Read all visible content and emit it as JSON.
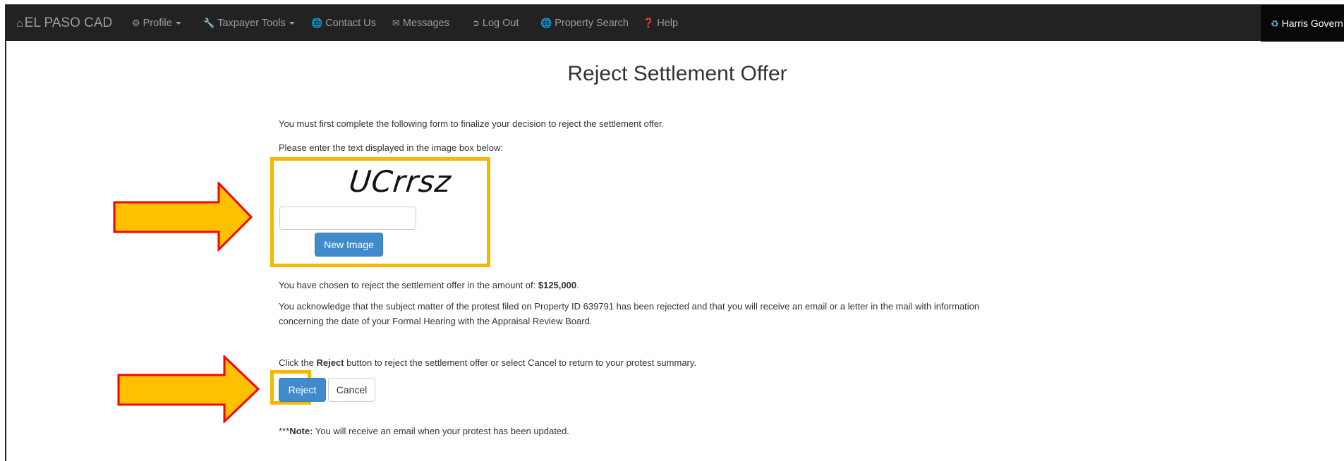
{
  "navbar": {
    "brand": "EL PASO CAD",
    "brand_icon": "home-icon",
    "items": [
      {
        "label": "Profile",
        "icon": "cogs-icon",
        "dropdown": true
      },
      {
        "label": "Taxpayer Tools",
        "icon": "wrench-icon",
        "dropdown": true
      },
      {
        "label": "Contact Us",
        "icon": "globe-icon"
      },
      {
        "label": "Messages",
        "icon": "envelope-icon"
      },
      {
        "label": "Log Out",
        "icon": "logout-icon"
      },
      {
        "label": "Property Search",
        "icon": "globe-icon"
      },
      {
        "label": "Help",
        "icon": "question-icon"
      }
    ],
    "right_label": "Harris Govern",
    "right_icon": "recycle-icon"
  },
  "page": {
    "title": "Reject Settlement Offer",
    "intro": "You must first complete the following form to finalize your decision to reject the settlement offer.",
    "captcha_prompt": "Please enter the text displayed in the image box below:",
    "captcha_text": "UCrrsz",
    "captcha_input_value": "",
    "new_image_label": "New Image",
    "amount_prefix": "You have chosen to reject the settlement offer in the amount of: ",
    "amount": "$125,000",
    "amount_suffix": ".",
    "ack_line1": "You acknowledge that the subject matter of the protest filed on Property ID 639791 has been rejected and that you will receive an email or a letter in the mail with information",
    "ack_line2": "concerning the date of your Formal Hearing with the Appraisal Review Board.",
    "click_prefix": "Click the ",
    "click_bold": "Reject",
    "click_suffix": " button to reject the settlement offer or select Cancel to return to your protest summary.",
    "reject_label": "Reject",
    "cancel_label": "Cancel",
    "note_prefix": "***",
    "note_bold": "Note:",
    "note_text": " You will receive an email when your protest has been updated."
  },
  "colors": {
    "navbar_bg": "#222222",
    "primary": "#428bca",
    "highlight_border": "#f5b800",
    "arrow_fill": "#ffc000",
    "arrow_stroke": "#ff0000"
  }
}
